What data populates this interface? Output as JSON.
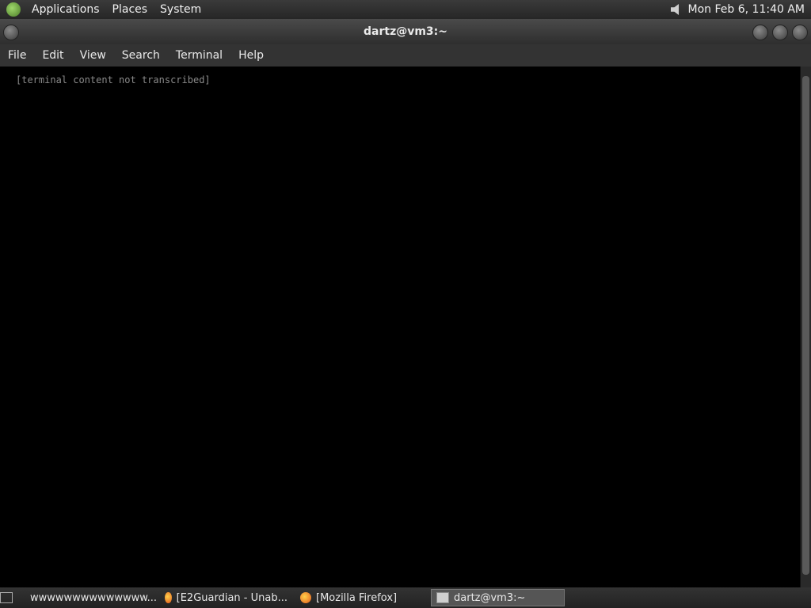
{
  "panel": {
    "menus": [
      "Applications",
      "Places",
      "System"
    ],
    "clock": "Mon Feb  6, 11:40 AM"
  },
  "window": {
    "title": "dartz@vm3:~",
    "menu": [
      "File",
      "Edit",
      "View",
      "Search",
      "Terminal",
      "Help"
    ]
  },
  "terminal": {
    "placeholder": "[terminal content not transcribed]"
  },
  "taskbar": {
    "items": [
      "wwwwwwwwwwwwww...",
      "[E2Guardian - Unab...",
      "[Mozilla Firefox]",
      "dartz@vm3:~"
    ]
  }
}
